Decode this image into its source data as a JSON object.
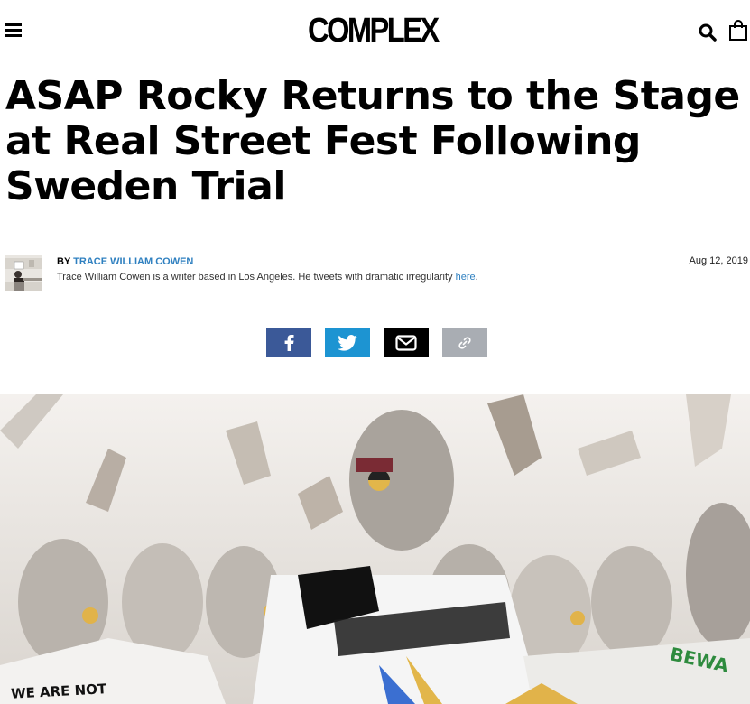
{
  "header": {
    "logo_text": "COMPLEX"
  },
  "article": {
    "title": "ASAP Rocky Returns to the Stage at Real Street Fest Following Sweden Trial",
    "byline_prefix": "BY",
    "author": "TRACE WILLIAM COWEN",
    "bio_text": "Trace William Cowen is a writer based in Los Angeles. He tweets with dramatic irregularity ",
    "bio_link": "here",
    "bio_end": ".",
    "date": "Aug 12, 2019"
  },
  "share": {
    "icons": [
      "facebook-icon",
      "twitter-icon",
      "email-icon",
      "link-icon"
    ]
  },
  "hero": {
    "shirt_text_left": "WE ARE NOT",
    "shirt_text_right": "BEWA"
  },
  "colors": {
    "facebook": "#3b5998",
    "twitter": "#1d94d2",
    "email": "#000000",
    "link": "#a9adb3",
    "author_link": "#2f80c0"
  }
}
